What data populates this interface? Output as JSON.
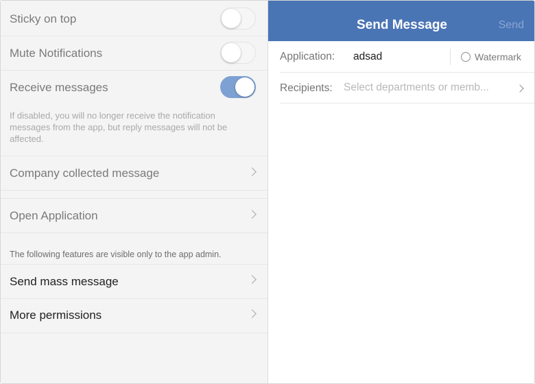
{
  "settings": {
    "sticky_label": "Sticky on top",
    "mute_label": "Mute Notifications",
    "receive_label": "Receive messages",
    "receive_note": "If disabled, you will no longer receive the notification messages from the app, but reply messages will not be affected.",
    "company_collected_label": "Company collected message",
    "open_application_label": "Open Application",
    "admin_note": "The following features are visible only to the app admin.",
    "send_mass_label": "Send mass message",
    "more_permissions_label": "More permissions",
    "toggles": {
      "sticky_on_top": false,
      "mute_notifications": false,
      "receive_messages": true
    }
  },
  "compose": {
    "title": "Send Message",
    "send_label": "Send",
    "application_label": "Application:",
    "application_value": "adsad",
    "watermark_label": "Watermark",
    "recipients_label": "Recipients:",
    "recipients_placeholder": "Select departments or memb..."
  },
  "colors": {
    "header_bg": "#4a75b5",
    "toggle_on": "#7ea1d3",
    "send_disabled": "#8aa6d3"
  },
  "icons": [
    "chevron-right-icon",
    "radio-icon"
  ]
}
